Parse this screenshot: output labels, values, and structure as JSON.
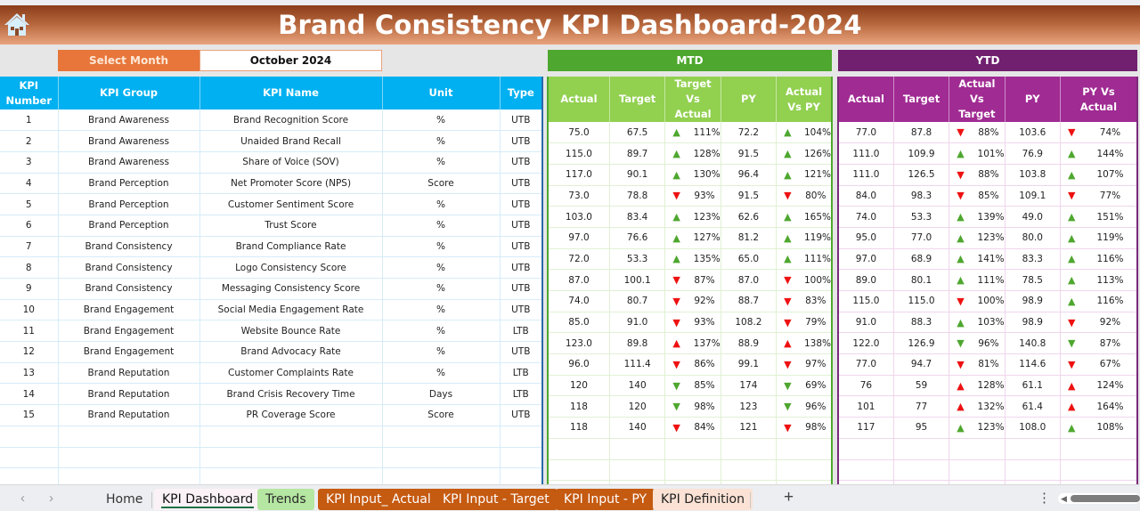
{
  "header": {
    "title": "Brand Consistency KPI Dashboard-2024",
    "home_icon": "home-icon"
  },
  "selector": {
    "label": "Select Month",
    "value": "October 2024"
  },
  "bands": {
    "mtd": "MTD",
    "ytd": "YTD"
  },
  "kpi_columns": [
    "KPI Number",
    "KPI Group",
    "KPI Name",
    "Unit",
    "Type"
  ],
  "mtd_columns": [
    "Actual",
    "Target",
    "Target Vs Actual",
    "PY",
    "Actual Vs PY"
  ],
  "ytd_columns": [
    "Actual",
    "Target",
    "Actual Vs Target",
    "PY",
    "PY Vs Actual"
  ],
  "colors": {
    "kpi_header": "#00b0f0",
    "mtd_band": "#4ea72e",
    "mtd_header": "#92d050",
    "ytd_band": "#70206f",
    "ytd_header": "#a02b93",
    "good": "#4ea72e",
    "bad": "#ee1111"
  },
  "rows": [
    {
      "num": "1",
      "group": "Brand Awareness",
      "name": "Brand Recognition Score",
      "unit": "%",
      "type": "UTB",
      "mtd": {
        "actual": "75.0",
        "target": "67.5",
        "tva": {
          "icon": "up-green",
          "pct": "111%"
        },
        "py": "72.2",
        "avp": {
          "icon": "up-green",
          "pct": "104%"
        }
      },
      "ytd": {
        "actual": "77.0",
        "target": "87.8",
        "avt": {
          "icon": "down-red",
          "pct": "88%"
        },
        "py": "103.6",
        "pva": {
          "icon": "down-red",
          "pct": "74%"
        }
      }
    },
    {
      "num": "2",
      "group": "Brand Awareness",
      "name": "Unaided Brand Recall",
      "unit": "%",
      "type": "UTB",
      "mtd": {
        "actual": "115.0",
        "target": "89.7",
        "tva": {
          "icon": "up-green",
          "pct": "128%"
        },
        "py": "91.5",
        "avp": {
          "icon": "up-green",
          "pct": "126%"
        }
      },
      "ytd": {
        "actual": "111.0",
        "target": "109.9",
        "avt": {
          "icon": "up-green",
          "pct": "101%"
        },
        "py": "76.9",
        "pva": {
          "icon": "up-green",
          "pct": "144%"
        }
      }
    },
    {
      "num": "3",
      "group": "Brand Awareness",
      "name": "Share of Voice (SOV)",
      "unit": "%",
      "type": "UTB",
      "mtd": {
        "actual": "117.0",
        "target": "90.1",
        "tva": {
          "icon": "up-green",
          "pct": "130%"
        },
        "py": "96.4",
        "avp": {
          "icon": "up-green",
          "pct": "121%"
        }
      },
      "ytd": {
        "actual": "111.0",
        "target": "126.5",
        "avt": {
          "icon": "down-red",
          "pct": "88%"
        },
        "py": "103.8",
        "pva": {
          "icon": "up-green",
          "pct": "107%"
        }
      }
    },
    {
      "num": "4",
      "group": "Brand Perception",
      "name": "Net Promoter Score (NPS)",
      "unit": "Score",
      "type": "UTB",
      "mtd": {
        "actual": "73.0",
        "target": "78.8",
        "tva": {
          "icon": "down-red",
          "pct": "93%"
        },
        "py": "91.5",
        "avp": {
          "icon": "down-red",
          "pct": "80%"
        }
      },
      "ytd": {
        "actual": "84.0",
        "target": "98.3",
        "avt": {
          "icon": "down-red",
          "pct": "85%"
        },
        "py": "109.1",
        "pva": {
          "icon": "down-red",
          "pct": "77%"
        }
      }
    },
    {
      "num": "5",
      "group": "Brand Perception",
      "name": "Customer Sentiment Score",
      "unit": "%",
      "type": "UTB",
      "mtd": {
        "actual": "103.0",
        "target": "83.4",
        "tva": {
          "icon": "up-green",
          "pct": "123%"
        },
        "py": "62.6",
        "avp": {
          "icon": "up-green",
          "pct": "165%"
        }
      },
      "ytd": {
        "actual": "74.0",
        "target": "53.3",
        "avt": {
          "icon": "up-green",
          "pct": "139%"
        },
        "py": "49.0",
        "pva": {
          "icon": "up-green",
          "pct": "151%"
        }
      }
    },
    {
      "num": "6",
      "group": "Brand Perception",
      "name": "Trust Score",
      "unit": "%",
      "type": "UTB",
      "mtd": {
        "actual": "97.0",
        "target": "76.6",
        "tva": {
          "icon": "up-green",
          "pct": "127%"
        },
        "py": "81.2",
        "avp": {
          "icon": "up-green",
          "pct": "119%"
        }
      },
      "ytd": {
        "actual": "95.0",
        "target": "77.0",
        "avt": {
          "icon": "up-green",
          "pct": "123%"
        },
        "py": "80.0",
        "pva": {
          "icon": "up-green",
          "pct": "119%"
        }
      }
    },
    {
      "num": "7",
      "group": "Brand Consistency",
      "name": "Brand Compliance Rate",
      "unit": "%",
      "type": "UTB",
      "mtd": {
        "actual": "72.0",
        "target": "53.3",
        "tva": {
          "icon": "up-green",
          "pct": "135%"
        },
        "py": "65.0",
        "avp": {
          "icon": "up-green",
          "pct": "111%"
        }
      },
      "ytd": {
        "actual": "97.0",
        "target": "68.9",
        "avt": {
          "icon": "up-green",
          "pct": "141%"
        },
        "py": "83.3",
        "pva": {
          "icon": "up-green",
          "pct": "116%"
        }
      }
    },
    {
      "num": "8",
      "group": "Brand Consistency",
      "name": "Logo Consistency Score",
      "unit": "%",
      "type": "UTB",
      "mtd": {
        "actual": "87.0",
        "target": "100.1",
        "tva": {
          "icon": "down-red",
          "pct": "87%"
        },
        "py": "87.0",
        "avp": {
          "icon": "down-red",
          "pct": "100%"
        }
      },
      "ytd": {
        "actual": "89.0",
        "target": "80.1",
        "avt": {
          "icon": "up-green",
          "pct": "111%"
        },
        "py": "78.5",
        "pva": {
          "icon": "up-green",
          "pct": "113%"
        }
      }
    },
    {
      "num": "9",
      "group": "Brand Consistency",
      "name": "Messaging Consistency Score",
      "unit": "%",
      "type": "UTB",
      "mtd": {
        "actual": "74.0",
        "target": "80.7",
        "tva": {
          "icon": "down-red",
          "pct": "92%"
        },
        "py": "88.7",
        "avp": {
          "icon": "down-red",
          "pct": "83%"
        }
      },
      "ytd": {
        "actual": "115.0",
        "target": "115.0",
        "avt": {
          "icon": "down-red",
          "pct": "100%"
        },
        "py": "98.9",
        "pva": {
          "icon": "up-green",
          "pct": "116%"
        }
      }
    },
    {
      "num": "10",
      "group": "Brand Engagement",
      "name": "Social Media Engagement Rate",
      "unit": "%",
      "type": "UTB",
      "mtd": {
        "actual": "85.0",
        "target": "91.0",
        "tva": {
          "icon": "down-red",
          "pct": "93%"
        },
        "py": "108.2",
        "avp": {
          "icon": "down-red",
          "pct": "79%"
        }
      },
      "ytd": {
        "actual": "91.0",
        "target": "88.3",
        "avt": {
          "icon": "up-green",
          "pct": "103%"
        },
        "py": "98.9",
        "pva": {
          "icon": "down-red",
          "pct": "92%"
        }
      }
    },
    {
      "num": "11",
      "group": "Brand Engagement",
      "name": "Website Bounce Rate",
      "unit": "%",
      "type": "LTB",
      "mtd": {
        "actual": "123.0",
        "target": "89.8",
        "tva": {
          "icon": "up-red",
          "pct": "137%"
        },
        "py": "88.9",
        "avp": {
          "icon": "up-red",
          "pct": "138%"
        }
      },
      "ytd": {
        "actual": "122.0",
        "target": "126.9",
        "avt": {
          "icon": "down-green",
          "pct": "96%"
        },
        "py": "140.8",
        "pva": {
          "icon": "down-green",
          "pct": "87%"
        }
      }
    },
    {
      "num": "12",
      "group": "Brand Engagement",
      "name": "Brand Advocacy Rate",
      "unit": "%",
      "type": "UTB",
      "mtd": {
        "actual": "96.0",
        "target": "111.4",
        "tva": {
          "icon": "down-red",
          "pct": "86%"
        },
        "py": "99.1",
        "avp": {
          "icon": "down-red",
          "pct": "97%"
        }
      },
      "ytd": {
        "actual": "77.0",
        "target": "94.7",
        "avt": {
          "icon": "down-red",
          "pct": "81%"
        },
        "py": "114.6",
        "pva": {
          "icon": "down-red",
          "pct": "67%"
        }
      }
    },
    {
      "num": "13",
      "group": "Brand Reputation",
      "name": "Customer Complaints Rate",
      "unit": "%",
      "type": "LTB",
      "mtd": {
        "actual": "120",
        "target": "140",
        "tva": {
          "icon": "down-green",
          "pct": "85%"
        },
        "py": "174",
        "avp": {
          "icon": "down-green",
          "pct": "69%"
        }
      },
      "ytd": {
        "actual": "76",
        "target": "59",
        "avt": {
          "icon": "up-red",
          "pct": "128%"
        },
        "py": "61.1",
        "pva": {
          "icon": "up-red",
          "pct": "124%"
        }
      }
    },
    {
      "num": "14",
      "group": "Brand Reputation",
      "name": "Brand Crisis Recovery Time",
      "unit": "Days",
      "type": "LTB",
      "mtd": {
        "actual": "118",
        "target": "120",
        "tva": {
          "icon": "down-green",
          "pct": "98%"
        },
        "py": "123",
        "avp": {
          "icon": "down-green",
          "pct": "96%"
        }
      },
      "ytd": {
        "actual": "101",
        "target": "77",
        "avt": {
          "icon": "up-red",
          "pct": "132%"
        },
        "py": "61.4",
        "pva": {
          "icon": "up-red",
          "pct": "164%"
        }
      }
    },
    {
      "num": "15",
      "group": "Brand Reputation",
      "name": "PR Coverage Score",
      "unit": "Score",
      "type": "UTB",
      "mtd": {
        "actual": "118",
        "target": "140",
        "tva": {
          "icon": "down-red",
          "pct": "84%"
        },
        "py": "121",
        "avp": {
          "icon": "down-red",
          "pct": "98%"
        }
      },
      "ytd": {
        "actual": "117",
        "target": "95",
        "avt": {
          "icon": "up-green",
          "pct": "123%"
        },
        "py": "108.0",
        "pva": {
          "icon": "up-green",
          "pct": "108%"
        }
      }
    }
  ],
  "empty_rows": 3,
  "tabs": {
    "home": "Home",
    "dashboard": "KPI Dashboard",
    "trends": "Trends",
    "input_actual": "KPI Input_ Actual",
    "input_target": "KPI Input - Target",
    "input_py": "KPI Input - PY",
    "definition": "KPI Definition",
    "add": "+",
    "prev": "‹",
    "next": "›",
    "more": "⋮"
  }
}
